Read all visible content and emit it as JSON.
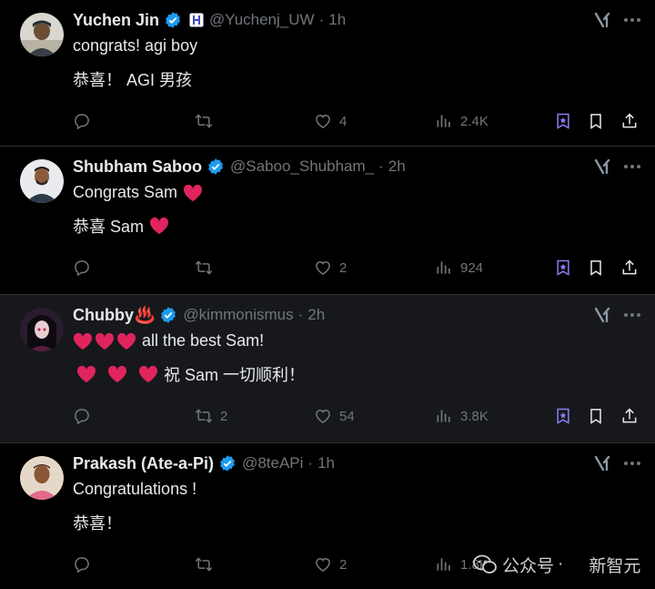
{
  "colors": {
    "background": "#000000",
    "highlight_row": "#16181c",
    "divider": "#2f3336",
    "text": "#e7e9ea",
    "muted": "#71767b",
    "verified": "#1d9bf0",
    "grok_accent": "#8b7ff5",
    "heart": "#e0245e"
  },
  "tweets": [
    {
      "name": "Yuchen Jin",
      "handle": "@Yuchenj_UW",
      "time": "1h",
      "line1": "congrats! agi boy",
      "line2": "恭喜！ AGI 男孩",
      "reply_count": "",
      "retweet_count": "",
      "like_count": "4",
      "view_count": "2.4K"
    },
    {
      "name": "Shubham Saboo",
      "handle": "@Saboo_Shubham_",
      "time": "2h",
      "line1": "Congrats Sam",
      "line2": "恭喜 Sam",
      "reply_count": "",
      "retweet_count": "",
      "like_count": "2",
      "view_count": "924"
    },
    {
      "name": "Chubby",
      "name_emoji": "♨️",
      "handle": "@kimmonismus",
      "time": "2h",
      "line1": "all the best Sam!",
      "line2": "祝 Sam 一切顺利！",
      "reply_count": "",
      "retweet_count": "2",
      "like_count": "54",
      "view_count": "3.8K"
    },
    {
      "name": "Prakash (Ate-a-Pi)",
      "handle": "@8teAPi",
      "time": "1h",
      "line1": "Congratulations !",
      "line2": "恭喜！",
      "reply_count": "",
      "retweet_count": "",
      "like_count": "2",
      "view_count": "1.8K"
    }
  ],
  "icons": {
    "verified": "verified-badge-icon",
    "affiliate": "affiliate-badge-icon",
    "grok": "grok-icon",
    "more": "more-options-icon",
    "reply": "reply-icon",
    "retweet": "retweet-icon",
    "like": "heart-icon",
    "views": "views-icon",
    "grok_action": "grok-action-icon",
    "bookmark": "bookmark-icon",
    "share": "share-icon"
  },
  "watermark": {
    "label1": "公众号",
    "separator": "·",
    "label2": "新智元"
  }
}
